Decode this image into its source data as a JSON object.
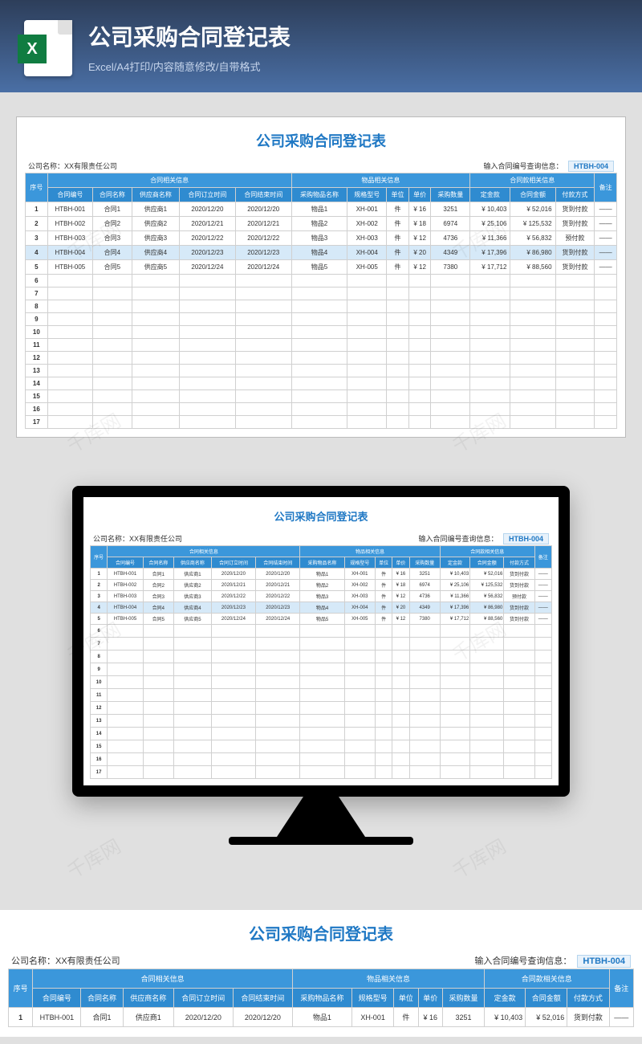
{
  "hero": {
    "title": "公司采购合同登记表",
    "subtitle": "Excel/A4打印/内容随意修改/自带格式"
  },
  "sheet": {
    "title": "公司采购合同登记表",
    "company_label": "公司名称：XX有限责任公司",
    "query_label": "输入合同编号查询信息：",
    "query_value": "HTBH-004"
  },
  "headers": {
    "seq": "序号",
    "group_contract": "合同相关信息",
    "group_item": "物品相关信息",
    "group_money": "合同款相关信息",
    "remark": "备注",
    "contract_no": "合同编号",
    "contract_name": "合同名称",
    "supplier": "供应商名称",
    "sign_date": "合同订立时间",
    "end_date": "合同结束时间",
    "item_name": "采购物品名称",
    "spec": "规格型号",
    "unit": "单位",
    "price": "单价",
    "qty": "采购数量",
    "deposit": "定金款",
    "total": "合同金额",
    "paymethod": "付款方式"
  },
  "rows": [
    {
      "seq": "1",
      "no": "HTBH-001",
      "name": "合同1",
      "sup": "供应商1",
      "d1": "2020/12/20",
      "d2": "2020/12/20",
      "item": "物品1",
      "spec": "XH-001",
      "unit": "件",
      "price": "¥ 16",
      "qty": "3251",
      "dep": "¥ 10,403",
      "tot": "¥ 52,016",
      "pay": "货到付款",
      "rem": "——",
      "sel": false
    },
    {
      "seq": "2",
      "no": "HTBH-002",
      "name": "合同2",
      "sup": "供应商2",
      "d1": "2020/12/21",
      "d2": "2020/12/21",
      "item": "物品2",
      "spec": "XH-002",
      "unit": "件",
      "price": "¥ 18",
      "qty": "6974",
      "dep": "¥ 25,106",
      "tot": "¥ 125,532",
      "pay": "货到付款",
      "rem": "——",
      "sel": false
    },
    {
      "seq": "3",
      "no": "HTBH-003",
      "name": "合同3",
      "sup": "供应商3",
      "d1": "2020/12/22",
      "d2": "2020/12/22",
      "item": "物品3",
      "spec": "XH-003",
      "unit": "件",
      "price": "¥ 12",
      "qty": "4736",
      "dep": "¥ 11,366",
      "tot": "¥ 56,832",
      "pay": "预付款",
      "rem": "——",
      "sel": false
    },
    {
      "seq": "4",
      "no": "HTBH-004",
      "name": "合同4",
      "sup": "供应商4",
      "d1": "2020/12/23",
      "d2": "2020/12/23",
      "item": "物品4",
      "spec": "XH-004",
      "unit": "件",
      "price": "¥ 20",
      "qty": "4349",
      "dep": "¥ 17,396",
      "tot": "¥ 86,980",
      "pay": "货到付款",
      "rem": "——",
      "sel": true
    },
    {
      "seq": "5",
      "no": "HTBH-005",
      "name": "合同5",
      "sup": "供应商5",
      "d1": "2020/12/24",
      "d2": "2020/12/24",
      "item": "物品5",
      "spec": "XH-005",
      "unit": "件",
      "price": "¥ 12",
      "qty": "7380",
      "dep": "¥ 17,712",
      "tot": "¥ 88,560",
      "pay": "货到付款",
      "rem": "——",
      "sel": false
    }
  ],
  "empty_seq": [
    "6",
    "7",
    "8",
    "9",
    "10",
    "11",
    "12",
    "13",
    "14",
    "15",
    "16",
    "17"
  ],
  "watermark": "千库网"
}
